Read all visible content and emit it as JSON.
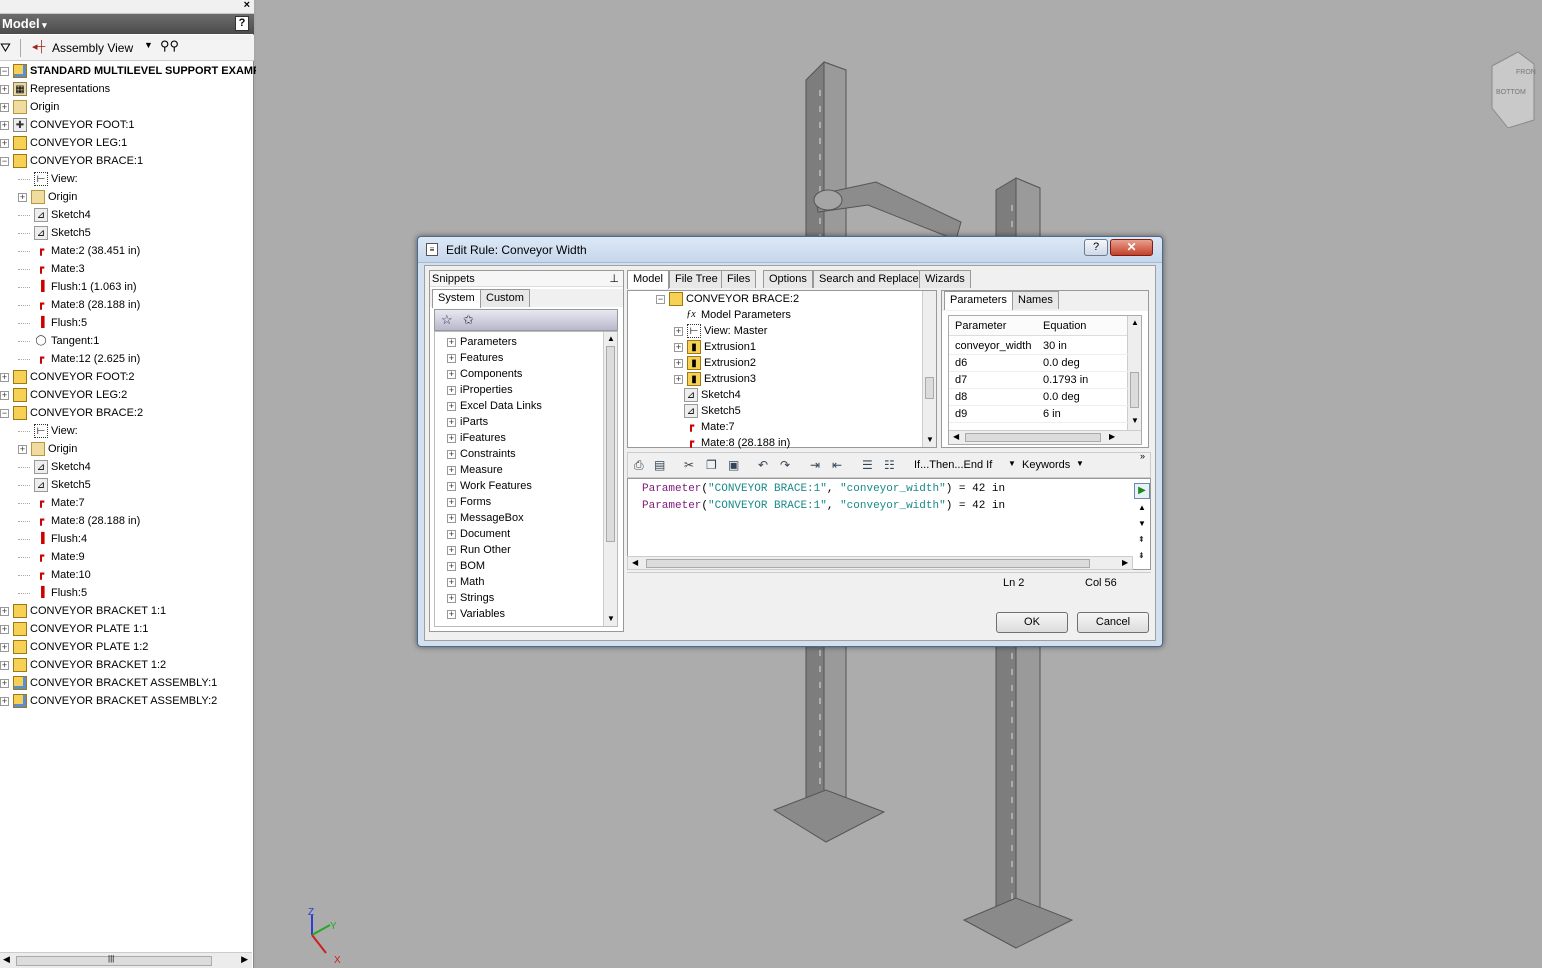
{
  "browser": {
    "title": "Model",
    "help": "?",
    "close": "×",
    "view_label": "Assembly View",
    "tree": [
      {
        "label": "STANDARD MULTILEVEL SUPPORT EXAMPL",
        "indent": 0,
        "icon": "asm",
        "pm": "-",
        "bold": true
      },
      {
        "label": "Representations",
        "indent": 0,
        "icon": "rep",
        "pm": "+"
      },
      {
        "label": "Origin",
        "indent": 0,
        "icon": "folder",
        "pm": "+"
      },
      {
        "label": "CONVEYOR FOOT:1",
        "indent": 0,
        "icon": "std",
        "pm": "+"
      },
      {
        "label": "CONVEYOR LEG:1",
        "indent": 0,
        "icon": "part",
        "pm": "+"
      },
      {
        "label": "CONVEYOR BRACE:1",
        "indent": 0,
        "icon": "part",
        "pm": "-"
      },
      {
        "label": "View:",
        "indent": 1,
        "icon": "view",
        "pm": ""
      },
      {
        "label": "Origin",
        "indent": 1,
        "icon": "folder",
        "pm": "+"
      },
      {
        "label": "Sketch4",
        "indent": 1,
        "icon": "sketch",
        "pm": ""
      },
      {
        "label": "Sketch5",
        "indent": 1,
        "icon": "sketch",
        "pm": ""
      },
      {
        "label": "Mate:2 (38.451 in)",
        "indent": 1,
        "icon": "mate",
        "pm": ""
      },
      {
        "label": "Mate:3",
        "indent": 1,
        "icon": "mate",
        "pm": ""
      },
      {
        "label": "Flush:1 (1.063 in)",
        "indent": 1,
        "icon": "flush",
        "pm": ""
      },
      {
        "label": "Mate:8 (28.188 in)",
        "indent": 1,
        "icon": "mate",
        "pm": ""
      },
      {
        "label": "Flush:5",
        "indent": 1,
        "icon": "flush",
        "pm": ""
      },
      {
        "label": "Tangent:1",
        "indent": 1,
        "icon": "tan",
        "pm": ""
      },
      {
        "label": "Mate:12 (2.625 in)",
        "indent": 1,
        "icon": "mate",
        "pm": ""
      },
      {
        "label": "CONVEYOR FOOT:2",
        "indent": 0,
        "icon": "part",
        "pm": "+"
      },
      {
        "label": "CONVEYOR LEG:2",
        "indent": 0,
        "icon": "part",
        "pm": "+"
      },
      {
        "label": "CONVEYOR BRACE:2",
        "indent": 0,
        "icon": "part",
        "pm": "-"
      },
      {
        "label": "View:",
        "indent": 1,
        "icon": "view",
        "pm": ""
      },
      {
        "label": "Origin",
        "indent": 1,
        "icon": "folder",
        "pm": "+"
      },
      {
        "label": "Sketch4",
        "indent": 1,
        "icon": "sketch",
        "pm": ""
      },
      {
        "label": "Sketch5",
        "indent": 1,
        "icon": "sketch",
        "pm": ""
      },
      {
        "label": "Mate:7",
        "indent": 1,
        "icon": "mate",
        "pm": ""
      },
      {
        "label": "Mate:8 (28.188 in)",
        "indent": 1,
        "icon": "mate",
        "pm": ""
      },
      {
        "label": "Flush:4",
        "indent": 1,
        "icon": "flush",
        "pm": ""
      },
      {
        "label": "Mate:9",
        "indent": 1,
        "icon": "mate",
        "pm": ""
      },
      {
        "label": "Mate:10",
        "indent": 1,
        "icon": "mate",
        "pm": ""
      },
      {
        "label": "Flush:5",
        "indent": 1,
        "icon": "flush",
        "pm": ""
      },
      {
        "label": "CONVEYOR BRACKET 1:1",
        "indent": 0,
        "icon": "part",
        "pm": "+"
      },
      {
        "label": "CONVEYOR PLATE 1:1",
        "indent": 0,
        "icon": "part",
        "pm": "+"
      },
      {
        "label": "CONVEYOR PLATE 1:2",
        "indent": 0,
        "icon": "part",
        "pm": "+"
      },
      {
        "label": "CONVEYOR BRACKET 1:2",
        "indent": 0,
        "icon": "part",
        "pm": "+"
      },
      {
        "label": "CONVEYOR BRACKET ASSEMBLY:1",
        "indent": 0,
        "icon": "asm",
        "pm": "+"
      },
      {
        "label": "CONVEYOR BRACKET ASSEMBLY:2",
        "indent": 0,
        "icon": "asm",
        "pm": "+"
      }
    ]
  },
  "viewport": {
    "viewcube_faces": [
      "FRON",
      "BOTTOM"
    ],
    "axes": [
      "Z",
      "Y",
      "X"
    ]
  },
  "dialog": {
    "title": "Edit Rule: Conveyor Width",
    "help_btn": "?",
    "close_btn": "✕",
    "snippets": {
      "header": "Snippets",
      "tabs": [
        "System",
        "Custom"
      ],
      "items": [
        "Parameters",
        "Features",
        "Components",
        "iProperties",
        "Excel Data Links",
        "iParts",
        "iFeatures",
        "Constraints",
        "Measure",
        "Work Features",
        "Forms",
        "MessageBox",
        "Document",
        "Run Other",
        "BOM",
        "Math",
        "Strings",
        "Variables"
      ]
    },
    "model_tabs": [
      "Model",
      "File Tree",
      "Files",
      "Options",
      "Search and Replace",
      "Wizards"
    ],
    "model_tree": [
      {
        "label": "CONVEYOR BRACE:2",
        "indent": 0,
        "icon": "part",
        "pm": "-"
      },
      {
        "label": "Model Parameters",
        "indent": 1,
        "icon": "fx",
        "pm": ""
      },
      {
        "label": "View: Master",
        "indent": 1,
        "icon": "view",
        "pm": "+"
      },
      {
        "label": "Extrusion1",
        "indent": 1,
        "icon": "ext",
        "pm": "+"
      },
      {
        "label": "Extrusion2",
        "indent": 1,
        "icon": "ext",
        "pm": "+"
      },
      {
        "label": "Extrusion3",
        "indent": 1,
        "icon": "ext",
        "pm": "+"
      },
      {
        "label": "Sketch4",
        "indent": 1,
        "icon": "sketch",
        "pm": ""
      },
      {
        "label": "Sketch5",
        "indent": 1,
        "icon": "sketch",
        "pm": ""
      },
      {
        "label": "Mate:7",
        "indent": 1,
        "icon": "mate",
        "pm": ""
      },
      {
        "label": "Mate:8 (28.188 in)",
        "indent": 1,
        "icon": "mate",
        "pm": ""
      }
    ],
    "param_tabs": [
      "Parameters",
      "Names"
    ],
    "param_headers": [
      "Parameter",
      "Equation"
    ],
    "param_rows": [
      {
        "name": "conveyor_width",
        "eq": "30 in"
      },
      {
        "name": "d6",
        "eq": "0.0 deg"
      },
      {
        "name": "d7",
        "eq": "0.1793 in"
      },
      {
        "name": "d8",
        "eq": "0.0 deg"
      },
      {
        "name": "d9",
        "eq": "6 in"
      }
    ],
    "toolbar": {
      "ifthen": "If...Then...End If",
      "keywords": "Keywords"
    },
    "code_lines": [
      {
        "kw": "Parameter",
        "open": "(",
        "a1": "\"CONVEYOR BRACE:1\"",
        "comma": ", ",
        "a2": "\"conveyor_width\"",
        "rest": ") = 42 in"
      },
      {
        "kw": "Parameter",
        "open": "(",
        "a1": "\"CONVEYOR BRACE:1\"",
        "comma": ", ",
        "a2": "\"conveyor_width\"",
        "rest": ") = 42 in"
      }
    ],
    "status": {
      "ln": "Ln 2",
      "col": "Col 56"
    },
    "ok": "OK",
    "cancel": "Cancel"
  }
}
